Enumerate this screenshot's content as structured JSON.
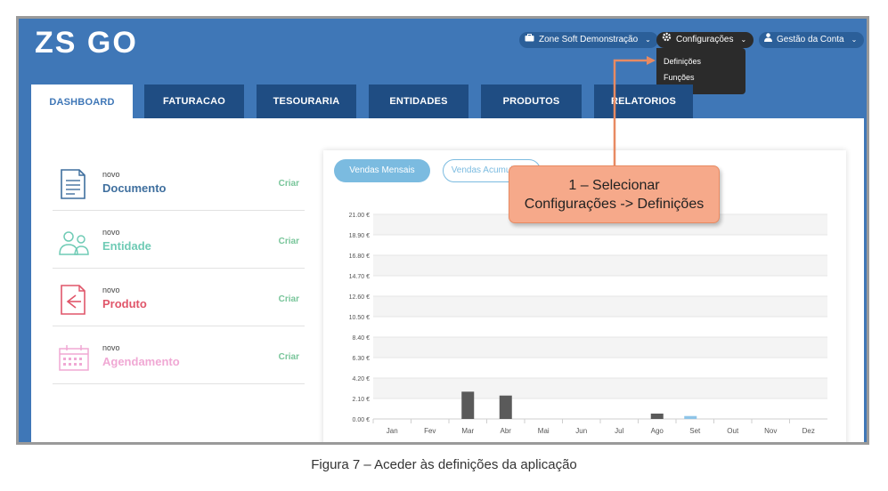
{
  "logo": {
    "text": "ZS GO"
  },
  "topnav": {
    "company": {
      "label": "Zone Soft Demonstração",
      "icon": "briefcase-icon"
    },
    "config": {
      "label": "Configurações",
      "icon": "gear-icon"
    },
    "account": {
      "label": "Gestão da Conta",
      "icon": "user-icon"
    }
  },
  "dropdown": {
    "items": [
      "Definições",
      "Funções"
    ]
  },
  "tabs": [
    "DASHBOARD",
    "FATURACAO",
    "TESOURARIA",
    "ENTIDADES",
    "PRODUTOS",
    "RELATORIOS"
  ],
  "quick_actions": [
    {
      "small": "novo",
      "title": "Documento",
      "create": "Criar",
      "color": "#3f6f9e",
      "icon": "document-icon"
    },
    {
      "small": "novo",
      "title": "Entidade",
      "create": "Criar",
      "color": "#6fcbb5",
      "icon": "users-icon"
    },
    {
      "small": "novo",
      "title": "Produto",
      "create": "Criar",
      "color": "#e0566a",
      "icon": "product-icon"
    },
    {
      "small": "novo",
      "title": "Agendamento",
      "create": "Criar",
      "color": "#f0a8d4",
      "icon": "calendar-icon"
    }
  ],
  "chart_tabs": {
    "monthly": "Vendas Mensais",
    "accumulated": "Vendas Acumuladas"
  },
  "chart_data": {
    "type": "bar",
    "categories": [
      "Jan",
      "Fev",
      "Mar",
      "Abr",
      "Mai",
      "Jun",
      "Jul",
      "Ago",
      "Set",
      "Out",
      "Nov",
      "Dez"
    ],
    "series": [
      {
        "values": [
          0,
          0,
          2.8,
          2.4,
          0,
          0,
          0,
          0.55,
          0,
          0,
          0,
          0
        ],
        "color": "#5a5a5a"
      },
      {
        "values": [
          0,
          0,
          0,
          0,
          0,
          0,
          0,
          0,
          0.3,
          0,
          0,
          0
        ],
        "color": "#8ec5e8"
      }
    ],
    "yticks": [
      "0.00 €",
      "2.10 €",
      "4.20 €",
      "6.30 €",
      "8.40 €",
      "10.50 €",
      "12.60 €",
      "14.70 €",
      "16.80 €",
      "18.90 €",
      "21.00 €"
    ],
    "ylim": [
      0,
      21
    ],
    "grid": true
  },
  "callout": {
    "line1": "1 – Selecionar",
    "line2": "Configurações -> Definições",
    "color": "#f6a98a"
  },
  "caption": "Figura 7 – Aceder às definições da aplicação"
}
